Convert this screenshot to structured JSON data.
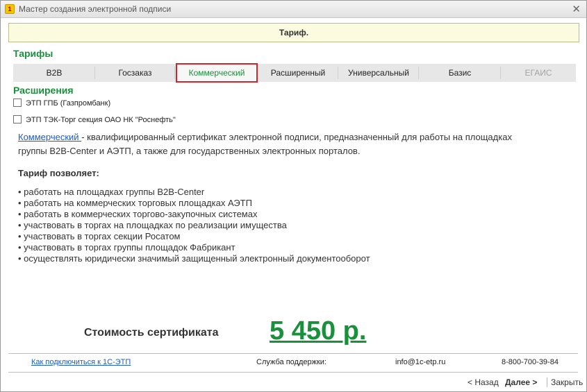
{
  "window": {
    "title": "Мастер создания электронной подписи",
    "app_icon": "1c-logo-icon",
    "close_symbol": "✕"
  },
  "header": {
    "title": "Тариф."
  },
  "tariffs": {
    "title": "Тарифы",
    "tabs": [
      {
        "label": "B2B"
      },
      {
        "label": "Госзаказ"
      },
      {
        "label": "Коммерческий",
        "selected": true
      },
      {
        "label": "Расширенный"
      },
      {
        "label": "Универсальный"
      },
      {
        "label": "Базис"
      },
      {
        "label": "ЕГАИС",
        "disabled": true
      }
    ]
  },
  "extensions": {
    "title": "Расширения",
    "items": [
      {
        "label": "ЭТП ГПБ (Газпромбанк)",
        "checked": false
      },
      {
        "label": "ЭТП ТЭК-Торг секция ОАО НК \"Роснефть\"",
        "checked": false
      }
    ]
  },
  "description": {
    "link": "Коммерческий ",
    "line1": " - квалифицированный сертификат электронной подписи, предназначенный для работы на площадках",
    "line2": "группы B2B-Center и АЭТП, а также для государственных электронных порталов."
  },
  "allows": {
    "title": "Тариф позволяет:",
    "items": [
      "работать на площадках группы B2B-Center",
      "работать на коммерческих торговых площадках АЭТП",
      "работать в коммерческих торгово-закупочных системах",
      "участвовать в торгах на площадках по реализации имущества",
      "участвовать в торгах секции Росатом",
      "участвовать в торгах группы площадок Фабрикант",
      "осуществлять юридически значимый защищенный электронный документооборот"
    ]
  },
  "cost": {
    "label": "Стоимость сертификата",
    "value": "5 450 р."
  },
  "footer": {
    "connect_link": "Как подключиться к 1С-ЭТП",
    "support_label": "Служба поддержки:",
    "email": "info@1c-etp.ru",
    "phone": "8-800-700-39-84"
  },
  "nav": {
    "back": "< Назад",
    "next": "Далее >",
    "close": "Закрыть"
  },
  "colors": {
    "accent_green": "#1a8f3c",
    "link_blue": "#1a5cc8",
    "selected_border": "#d2232a",
    "header_bg": "#fbfbe0"
  }
}
